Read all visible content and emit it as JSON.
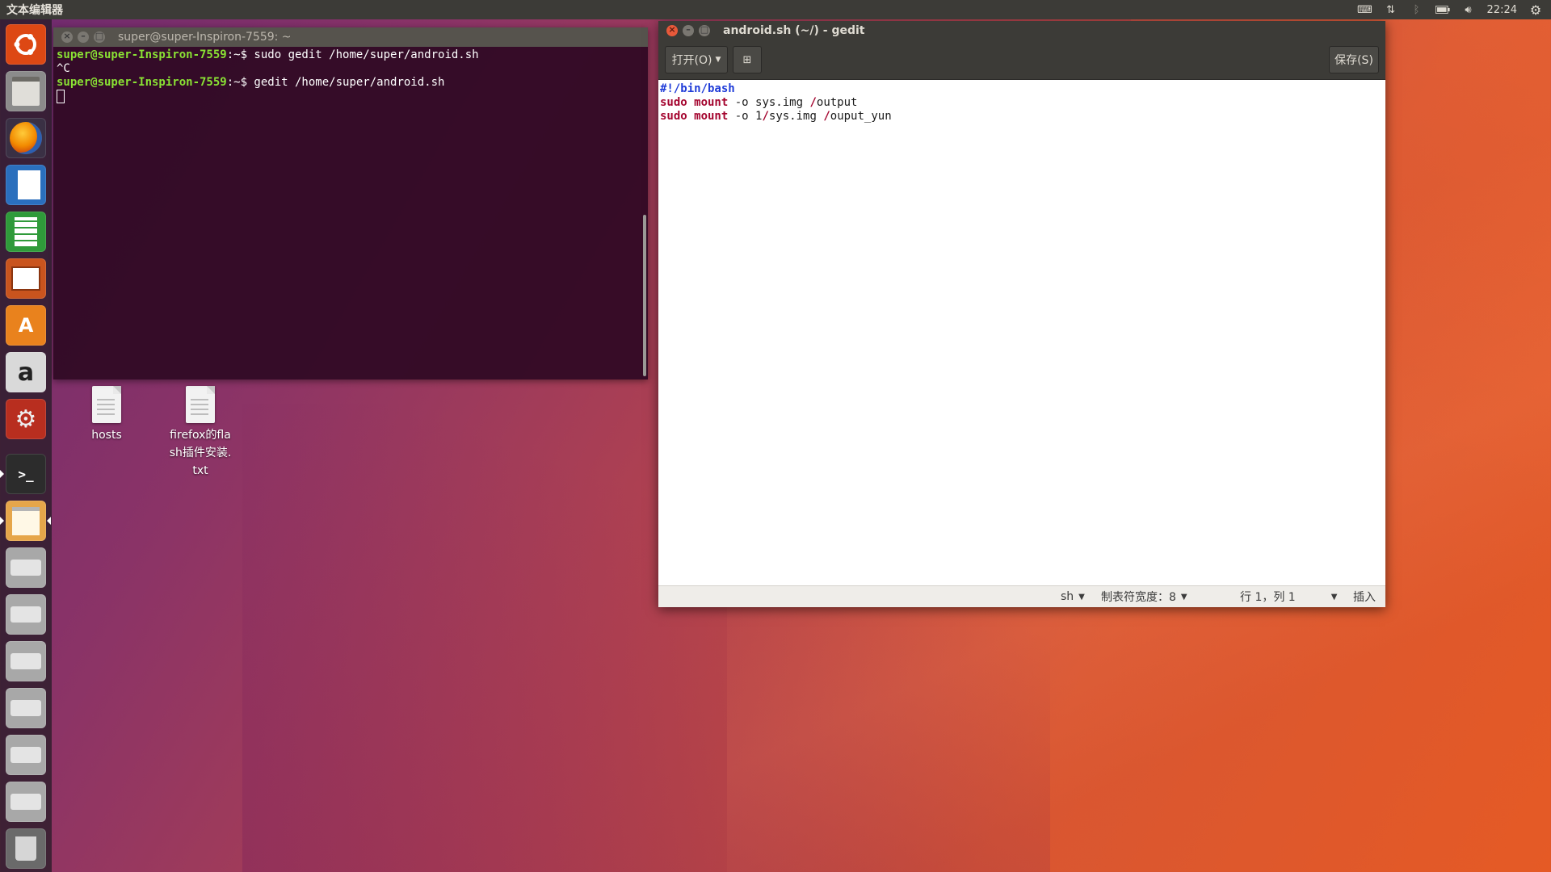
{
  "top_panel": {
    "app_title": "文本编辑器",
    "clock": "22:24",
    "tray_icons": [
      "keyboard-icon",
      "network-icon",
      "bluetooth-icon",
      "battery-icon",
      "volume-icon",
      "gear-icon"
    ]
  },
  "launcher": {
    "items": [
      {
        "name": "ubuntu-dash",
        "color": "#dd4814"
      },
      {
        "name": "files",
        "color": "#8b8b8b"
      },
      {
        "name": "firefox",
        "color": "#e66000"
      },
      {
        "name": "libreoffice-writer",
        "color": "#2a6fbd"
      },
      {
        "name": "libreoffice-calc",
        "color": "#2f9a3a"
      },
      {
        "name": "libreoffice-impress",
        "color": "#c9541e"
      },
      {
        "name": "software-center",
        "color": "#e9821d"
      },
      {
        "name": "amazon",
        "color": "#c9c9c9"
      },
      {
        "name": "system-settings",
        "color": "#b82e1f"
      },
      {
        "name": "terminal",
        "color": "#333333"
      },
      {
        "name": "gedit",
        "color": "#e6a64a"
      },
      {
        "name": "drive-1",
        "color": "#a8a8a8"
      },
      {
        "name": "drive-2",
        "color": "#a8a8a8"
      },
      {
        "name": "drive-3",
        "color": "#a8a8a8"
      },
      {
        "name": "drive-4",
        "color": "#a8a8a8"
      },
      {
        "name": "drive-5",
        "color": "#a8a8a8"
      },
      {
        "name": "drive-6",
        "color": "#a8a8a8"
      },
      {
        "name": "trash",
        "color": "#9c9c9c"
      }
    ]
  },
  "desktop": {
    "icons": [
      {
        "label": "hosts"
      },
      {
        "label": "firefox的flash插件安装.txt"
      }
    ]
  },
  "terminal": {
    "title": "super@super-Inspiron-7559: ~",
    "lines": [
      {
        "user": "super@super-Inspiron-7559",
        "path": ":~",
        "cmd": "$ sudo gedit /home/super/android.sh"
      },
      {
        "text": "^C"
      },
      {
        "user": "super@super-Inspiron-7559",
        "path": ":~",
        "cmd": "$ gedit /home/super/android.sh"
      }
    ]
  },
  "gedit": {
    "title": "android.sh (~/) - gedit",
    "open_label": "打开(O)",
    "save_label": "保存(S)",
    "code": {
      "line1": "#!/bin/bash",
      "line2_cmd": "sudo mount",
      "line2_rest": " -o sys.img ",
      "line2_slash": "/",
      "line2_tail": "output",
      "line3_cmd": "sudo mount",
      "line3_rest": " -o 1",
      "line3_slash1": "/",
      "line3_mid": "sys.img ",
      "line3_slash2": "/",
      "line3_tail": "ouput_yun"
    },
    "status": {
      "language": "sh",
      "tab_width": "制表符宽度：8",
      "position": "行 1，列 1",
      "mode": "插入"
    }
  }
}
